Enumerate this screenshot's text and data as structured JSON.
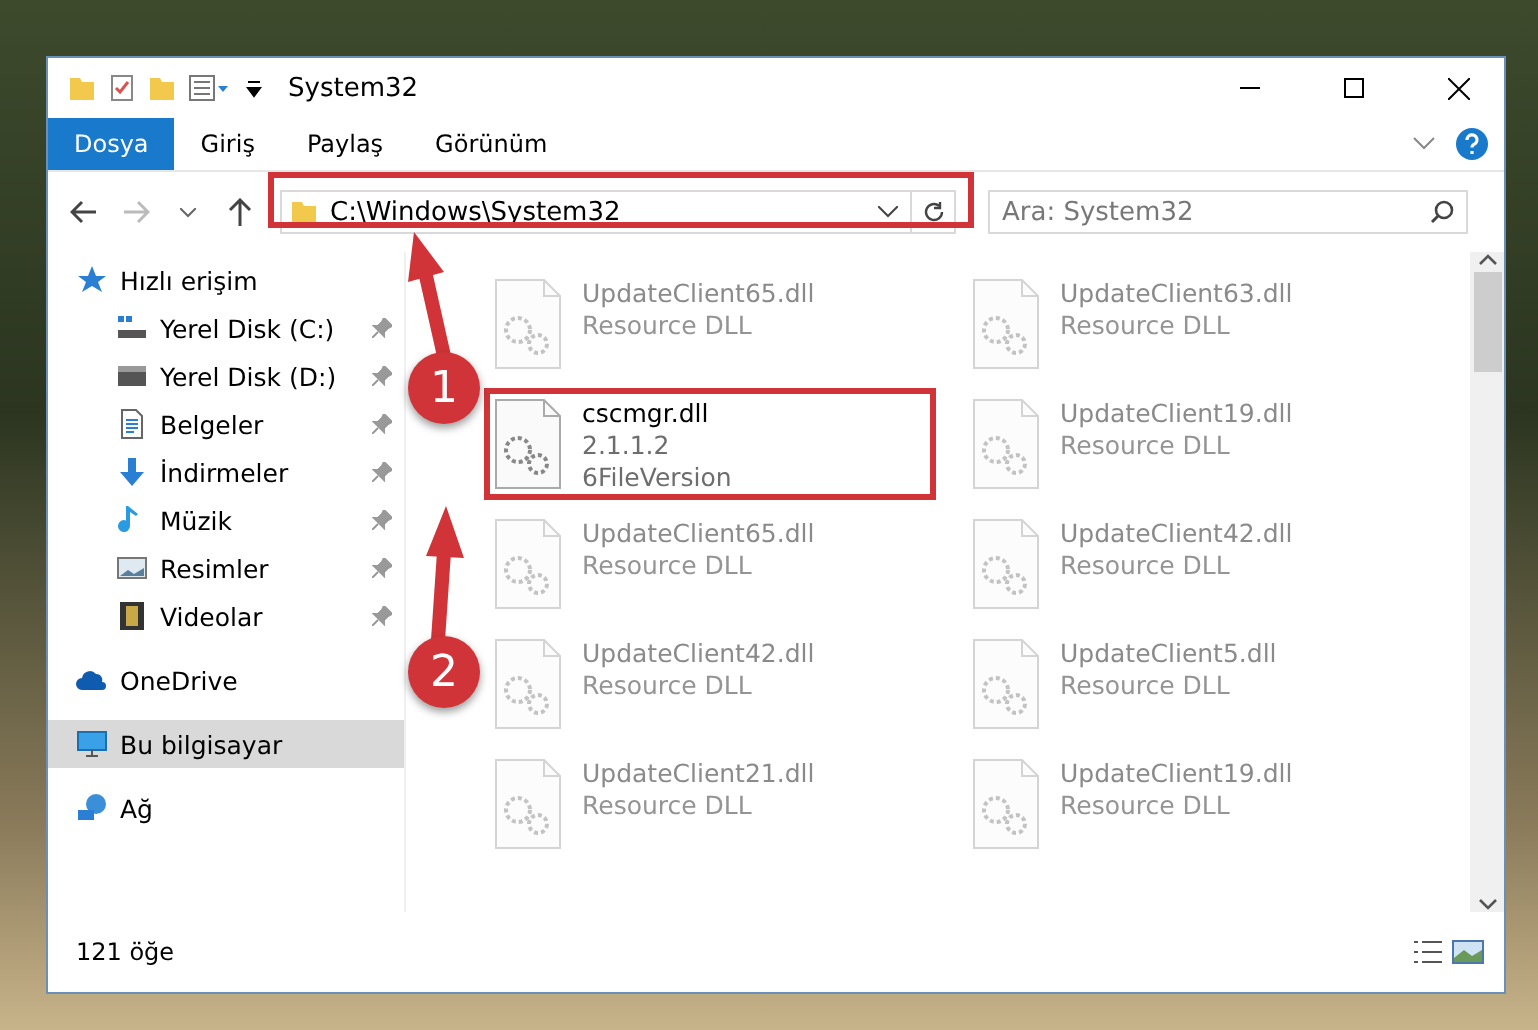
{
  "window": {
    "title": "System32"
  },
  "ribbon_tabs": [
    {
      "label": "Dosya",
      "selected": true
    },
    {
      "label": "Giriş",
      "selected": false
    },
    {
      "label": "Paylaş",
      "selected": false
    },
    {
      "label": "Görünüm",
      "selected": false
    }
  ],
  "address_bar": {
    "path": "C:\\Windows\\System32"
  },
  "search": {
    "placeholder": "Ara: System32"
  },
  "sidebar": {
    "items": [
      {
        "label": "Hızlı erişim",
        "kind": "star",
        "selected": false,
        "children": [
          {
            "label": "Yerel Disk (C:)",
            "kind": "system-drive",
            "pinned": true,
            "selected": false
          },
          {
            "label": "Yerel Disk (D:)",
            "kind": "drive",
            "pinned": true,
            "selected": false
          },
          {
            "label": "Belgeler",
            "kind": "documents",
            "pinned": true,
            "selected": false
          },
          {
            "label": "İndirmeler",
            "kind": "download",
            "pinned": true,
            "selected": false
          },
          {
            "label": "Müzik",
            "kind": "music",
            "pinned": true,
            "selected": false
          },
          {
            "label": "Resimler",
            "kind": "pictures",
            "pinned": true,
            "selected": false
          },
          {
            "label": "Videolar",
            "kind": "videos",
            "pinned": true,
            "selected": false
          }
        ]
      },
      {
        "label": "OneDrive",
        "kind": "cloud",
        "selected": false
      },
      {
        "label": "Bu bilgisayar",
        "kind": "computer",
        "selected": true
      },
      {
        "label": "Ağ",
        "kind": "network",
        "selected": false
      }
    ]
  },
  "files": [
    {
      "name": "UpdateClient65.dll",
      "detail_1": "Resource DLL",
      "blurred": true,
      "highlighted": false
    },
    {
      "name": "UpdateClient63.dll",
      "detail_1": "Resource DLL",
      "blurred": true,
      "highlighted": false
    },
    {
      "name": "cscmgr.dll",
      "detail_1": "2.1.1.2",
      "detail_2": "6FileVersion",
      "blurred": false,
      "highlighted": true
    },
    {
      "name": "UpdateClient19.dll",
      "detail_1": "Resource DLL",
      "blurred": true,
      "highlighted": false
    },
    {
      "name": "UpdateClient65.dll",
      "detail_1": "Resource DLL",
      "blurred": true,
      "highlighted": false
    },
    {
      "name": "UpdateClient42.dll",
      "detail_1": "Resource DLL",
      "blurred": true,
      "highlighted": false
    },
    {
      "name": "UpdateClient42.dll",
      "detail_1": "Resource DLL",
      "blurred": true,
      "highlighted": false
    },
    {
      "name": "UpdateClient5.dll",
      "detail_1": "Resource DLL",
      "blurred": true,
      "highlighted": false
    },
    {
      "name": "UpdateClient21.dll",
      "detail_1": "Resource DLL",
      "blurred": true,
      "highlighted": false
    },
    {
      "name": "UpdateClient19.dll",
      "detail_1": "Resource DLL",
      "blurred": true,
      "highlighted": false
    }
  ],
  "status_bar": {
    "item_count": "121 öğe"
  },
  "annotations": [
    {
      "number": "1"
    },
    {
      "number": "2"
    }
  ]
}
